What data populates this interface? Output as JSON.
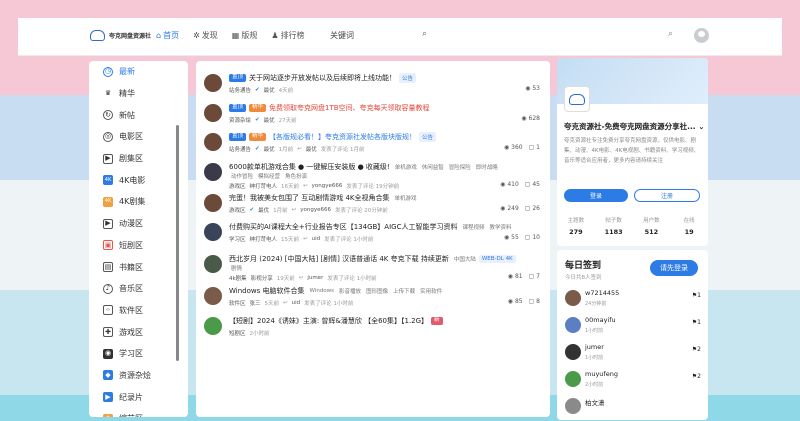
{
  "header": {
    "logo_text": "夸克网盘资源社",
    "nav": [
      {
        "icon": "home-icon",
        "glyph": "⌂",
        "label": "首页",
        "active": true
      },
      {
        "icon": "gear-icon",
        "glyph": "✲",
        "label": "发现"
      },
      {
        "icon": "grid-icon",
        "glyph": "▦",
        "label": "版规"
      },
      {
        "icon": "users-icon",
        "glyph": "♟",
        "label": "排行榜"
      }
    ],
    "search_label": "关键词"
  },
  "sidebar": {
    "items": [
      {
        "label": "最新",
        "icon": "clock-icon",
        "glyph": "◷",
        "active": true
      },
      {
        "label": "精华",
        "icon": "crown-icon",
        "glyph": "♛"
      },
      {
        "label": "新帖",
        "icon": "refresh-icon",
        "glyph": "↻"
      },
      {
        "label": "电影区",
        "icon": "film-icon",
        "glyph": "◎"
      },
      {
        "label": "剧集区",
        "icon": "tv-icon",
        "glyph": "▶"
      },
      {
        "label": "4K电影",
        "icon": "4k-icon",
        "glyph": "4K"
      },
      {
        "label": "4K剧集",
        "icon": "4k-series-icon",
        "glyph": "4K"
      },
      {
        "label": "动漫区",
        "icon": "anime-icon",
        "glyph": "▶"
      },
      {
        "label": "短剧区",
        "icon": "short-drama-icon",
        "glyph": "▣"
      },
      {
        "label": "书籍区",
        "icon": "book-icon",
        "glyph": "▤"
      },
      {
        "label": "音乐区",
        "icon": "music-icon",
        "glyph": "♪"
      },
      {
        "label": "软件区",
        "icon": "code-icon",
        "glyph": "‹›"
      },
      {
        "label": "游戏区",
        "icon": "gamepad-icon",
        "glyph": "✚"
      },
      {
        "label": "学习区",
        "icon": "study-icon",
        "glyph": "◉"
      },
      {
        "label": "资源杂烩",
        "icon": "bag-icon",
        "glyph": "◆"
      },
      {
        "label": "纪录片",
        "icon": "documentary-icon",
        "glyph": "▶"
      },
      {
        "label": "综艺区",
        "icon": "variety-icon",
        "glyph": "★"
      }
    ]
  },
  "posts": [
    {
      "badges": [
        {
          "t": "置顶",
          "k": "top"
        }
      ],
      "title": "关于网站逐步开放发帖以及后续即将上线功能！",
      "title_style": "",
      "tags": [
        {
          "t": "公告",
          "k": "blue"
        }
      ],
      "author": "站务通告",
      "verified": true,
      "extra": "",
      "cat": "",
      "time": "最优",
      "ago": "4天前",
      "replier": "",
      "views": "53",
      "comments": ""
    },
    {
      "badges": [
        {
          "t": "置顶",
          "k": "top"
        },
        {
          "t": "精华",
          "k": "hot"
        }
      ],
      "title": "免费领取夸克网盘1TB空间、夸克每天领取容量教程",
      "title_style": "red",
      "tags": [],
      "author": "资源杂烩",
      "verified": true,
      "extra": "",
      "cat": "",
      "time": "最优",
      "ago": "27天前",
      "replier": "",
      "views": "628",
      "comments": ""
    },
    {
      "badges": [
        {
          "t": "置顶",
          "k": "top"
        },
        {
          "t": "精华",
          "k": "hot"
        }
      ],
      "title": "【各版规必看！】夸克资源社发帖各版块版规！",
      "title_style": "blue",
      "tags": [
        {
          "t": "公告",
          "k": "blue"
        }
      ],
      "author": "站务通告",
      "verified": true,
      "extra": "",
      "cat": "",
      "time": "最优",
      "ago": "1月前",
      "replier": "最优",
      "reply_text": "发表了评论 1月前",
      "views": "360",
      "comments": "1"
    },
    {
      "badges": [],
      "title": "6000款单机游戏合集 ● 一键解压安装版 ● 收藏级!",
      "title_style": "",
      "tags": [
        {
          "t": "单机游戏",
          "k": "gray"
        },
        {
          "t": "休闲益智",
          "k": "gray"
        },
        {
          "t": "冒险探险",
          "k": "gray"
        },
        {
          "t": "即时战略",
          "k": "gray"
        }
      ],
      "tags2": [
        "动作冒险",
        "模拟经营",
        "角色扮演"
      ],
      "author": "游戏区",
      "verified": false,
      "extra": "绅打苛电人",
      "cat": "",
      "time": "",
      "ago": "16天前",
      "replier": "yongye666",
      "reply_text": "发表了评论 19分钟前",
      "views": "410",
      "comments": "45"
    },
    {
      "badges": [],
      "title": "完蛋！我被美女包围了 互动剧情游戏 4K全视角合集",
      "title_style": "",
      "tags": [
        {
          "t": "单机游戏",
          "k": "gray"
        }
      ],
      "author": "游戏区",
      "verified": true,
      "extra": "",
      "cat": "",
      "time": "最优",
      "ago": "1月前",
      "replier": "yongye666",
      "reply_text": "发表了评论 20分钟前",
      "views": "249",
      "comments": "26"
    },
    {
      "badges": [],
      "title": "付费购买的AI课程大全+行业报告专区【134GB】AIGC人工智能学习资料",
      "title_style": "",
      "tags": [
        {
          "t": "课程视频",
          "k": "gray"
        },
        {
          "t": "教学资料",
          "k": "gray"
        }
      ],
      "author": "学习区",
      "verified": false,
      "extra": "绅打苛电人",
      "cat": "",
      "time": "",
      "ago": "15天前",
      "replier": "uid",
      "reply_text": "发表了评论 1小时前",
      "views": "55",
      "comments": "10"
    },
    {
      "badges": [],
      "title": "西北岁月 (2024) [中国大陆] [剧情] 汉语普通话 4K 夸克下载 持续更新",
      "title_style": "",
      "tags": [
        {
          "t": "中国大陆",
          "k": "gray"
        },
        {
          "t": "WEB-DL 4K",
          "k": "blue"
        }
      ],
      "tags2": [
        "剧情"
      ],
      "author": "4k剧集",
      "verified": false,
      "extra": "影视分享",
      "cat": "",
      "time": "",
      "ago": "19天前",
      "replier": "jumer",
      "reply_text": "发表了评论 1小时前",
      "views": "81",
      "comments": "7"
    },
    {
      "badges": [],
      "title": "Windows 电脑软件合集",
      "title_style": "",
      "tags": [
        {
          "t": "Windows",
          "k": "gray"
        },
        {
          "t": "影音播放",
          "k": "gray"
        },
        {
          "t": "图形图像",
          "k": "gray"
        },
        {
          "t": "上传下载",
          "k": "gray"
        },
        {
          "t": "实用软件",
          "k": "gray"
        }
      ],
      "author": "软件区",
      "verified": false,
      "extra": "张三",
      "cat": "",
      "time": "",
      "ago": "5天前",
      "replier": "uid",
      "reply_text": "发表了评论 1小时前",
      "views": "85",
      "comments": "8"
    },
    {
      "badges": [],
      "title": "【短剧】2024《诱妹》主演: 曾辉&潘慧欣 【全60集】【1.2G】",
      "title_style": "",
      "tags": [
        {
          "t": "新",
          "k": "new"
        }
      ],
      "author": "短剧区",
      "verified": false,
      "extra": "",
      "cat": "",
      "time": "",
      "ago": "2小时前",
      "replier": "",
      "reply_text": "",
      "views": "",
      "comments": ""
    }
  ],
  "right_card": {
    "name": "夸克资源社-免费夸克网盘资源分享社...",
    "description": "夸克资源社专注免费分享夸克网盘资源，仅供电影、剧集、动漫、4K电影、4K电视剧、书籍资料、学习视频、音乐等适合应用者，更多内容请持续关注",
    "login": "登录",
    "register": "注册",
    "stats": [
      {
        "label": "主题数",
        "value": "279"
      },
      {
        "label": "帖子数",
        "value": "1183"
      },
      {
        "label": "用户数",
        "value": "512"
      },
      {
        "label": "在线",
        "value": "19"
      }
    ]
  },
  "sign_card": {
    "title": "每日签到",
    "subtitle": "今日共8人签到",
    "button": "请先登录",
    "users": [
      {
        "name": "w7214455",
        "time": "24分钟前",
        "count": "1",
        "color": "#7a5a48"
      },
      {
        "name": "00mayifu",
        "time": "1小时前",
        "count": "1",
        "color": "#5b7fc2"
      },
      {
        "name": "jumer",
        "time": "1小时前",
        "count": "2",
        "color": "#333333"
      },
      {
        "name": "muyufeng",
        "time": "2小时前",
        "count": "2",
        "color": "#4a9a4a"
      },
      {
        "name": "柏文潇",
        "time": "",
        "count": "",
        "color": "#8a8a8a"
      }
    ]
  }
}
